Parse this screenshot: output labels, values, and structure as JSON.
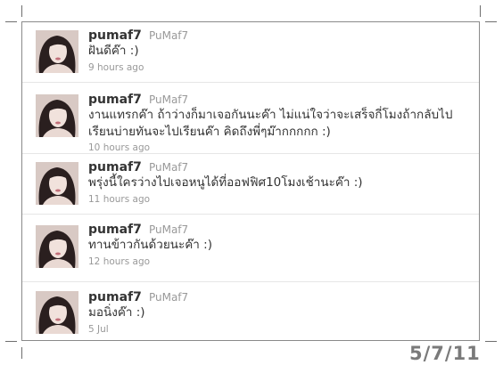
{
  "tweets": [
    {
      "screen_name": "pumaf7",
      "name": "PuMaf7",
      "text": "ฝันดีค๊า :)",
      "time": "9 hours ago"
    },
    {
      "screen_name": "pumaf7",
      "name": "PuMaf7",
      "text": "งานแทรกค๊า ถ้าว่างก็มาเจอกันนะค๊า ไม่แน่ใจว่าจะเสร็จกี่โมงถ้ากลับไปเรียนบ่ายทันจะไปเรียนค๊า คิดถึงพี่ๆม๊ากกกกก :)",
      "time": "10 hours ago"
    },
    {
      "screen_name": "pumaf7",
      "name": "PuMaf7",
      "text": "พรุ่งนี้ใครว่างไปเจอหนูได้ที่ออฟฟิศ10โมงเช้านะค๊า :)",
      "time": "11 hours ago"
    },
    {
      "screen_name": "pumaf7",
      "name": "PuMaf7",
      "text": "ทานข้าวกันด้วยนะค๊า :)",
      "time": "12 hours ago"
    },
    {
      "screen_name": "pumaf7",
      "name": "PuMaf7",
      "text": "มอนิ่งค๊า :)",
      "time": "5 Jul"
    }
  ],
  "date_stamp": "5/7/11",
  "colors": {
    "screen_name": "#333333",
    "name": "#999999",
    "text": "#333333",
    "time": "#999999",
    "border": "#8a8a8a",
    "stamp": "#7a7a7a"
  }
}
